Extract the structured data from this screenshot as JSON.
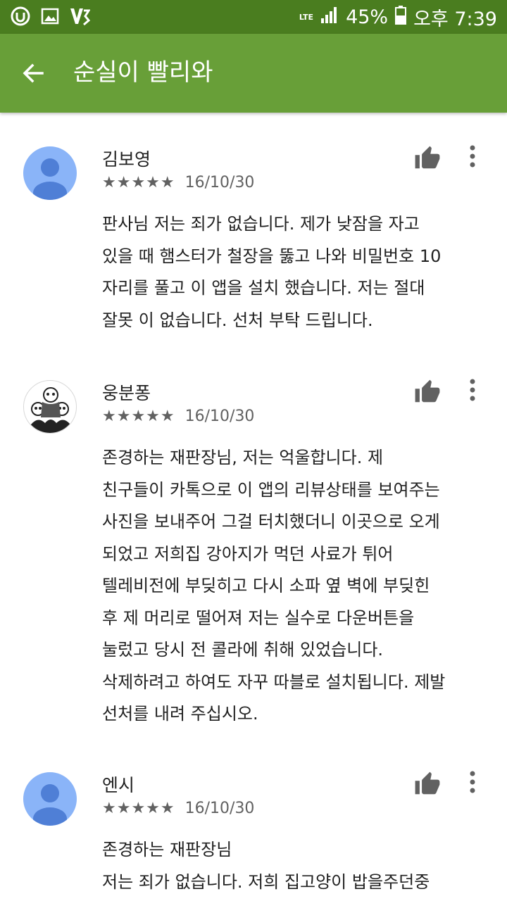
{
  "status_bar": {
    "network": "LTE",
    "battery": "45%",
    "time": "오후 7:39"
  },
  "app_bar": {
    "title": "순실이 빨리와"
  },
  "reviews": [
    {
      "name": "김보영",
      "stars": "★★★★★",
      "rating": 5,
      "date": "16/10/30",
      "lines": [
        "판사님 저는 죄가 없습니다. 제가 낮잠을 자고",
        "있을 때 햄스터가 철장을 뚫고 나와 비밀번호 10",
        "자리를 풀고 이 앱을 설치 했습니다. 저는 절대",
        "잘못 이 없습니다. 선처 부탁 드립니다."
      ]
    },
    {
      "name": "웅분퐁",
      "stars": "★★★★★",
      "rating": 5,
      "date": "16/10/30",
      "lines": [
        "존경하는 재판장님, 저는 억울합니다. 제",
        "친구들이 카톡으로 이 앱의 리뷰상태를 보여주는",
        "사진을 보내주어 그걸 터치했더니 이곳으로 오게",
        "되었고 저희집 강아지가 먹던 사료가 튀어",
        "텔레비전에 부딪히고 다시 소파 옆 벽에 부딪힌",
        "후 제 머리로 떨어져 저는 실수로 다운버튼을",
        "눌렀고 당시 전 콜라에 취해 있었습니다.",
        "삭제하려고 하여도 자꾸 따블로 설치됩니다. 제발",
        "선처를 내려 주십시오."
      ]
    },
    {
      "name": "엔시",
      "stars": "★★★★★",
      "rating": 5,
      "date": "16/10/30",
      "lines": [
        "존경하는 재판장님",
        "저는 죄가 없습니다. 저희 집고양이 밥을주던중"
      ]
    }
  ],
  "icons": {
    "back": "arrow-back-icon",
    "thumb": "thumb-up-icon",
    "more": "more-vert-icon"
  },
  "colors": {
    "status_bar": "#4a7d1f",
    "app_bar": "#689f38",
    "avatar_default": "#8ab4f8",
    "avatar_figure": "#4f7fd6",
    "icon_gray": "#616161"
  }
}
